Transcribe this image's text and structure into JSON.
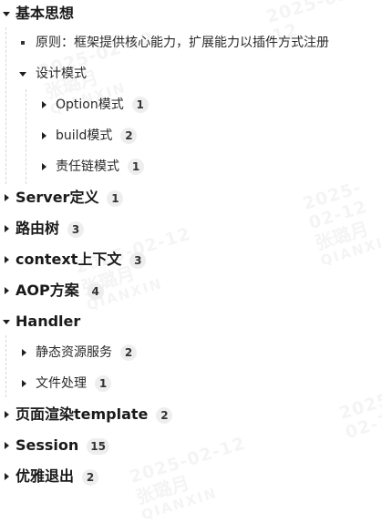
{
  "tree": {
    "nodes": [
      {
        "label": "基本思想",
        "count": null,
        "expanded": true
      },
      {
        "label": "原则：框架提供核心能力，扩展能力以插件方式注册",
        "count": null
      },
      {
        "label": "设计模式",
        "count": null,
        "expanded": true
      },
      {
        "label": "Option模式",
        "count": "1",
        "expanded": false
      },
      {
        "label": "build模式",
        "count": "2",
        "expanded": false
      },
      {
        "label": "责任链模式",
        "count": "1",
        "expanded": false
      },
      {
        "label": "Server定义",
        "count": "1",
        "expanded": false
      },
      {
        "label": "路由树",
        "count": "3",
        "expanded": false
      },
      {
        "label": "context上下文",
        "count": "3",
        "expanded": false
      },
      {
        "label": "AOP方案",
        "count": "4",
        "expanded": false
      },
      {
        "label": "Handler",
        "count": null,
        "expanded": true
      },
      {
        "label": "静态资源服务",
        "count": "2",
        "expanded": false
      },
      {
        "label": "文件处理",
        "count": "1",
        "expanded": false
      },
      {
        "label": "页面渲染template",
        "count": "2",
        "expanded": false
      },
      {
        "label": "Session",
        "count": "15",
        "expanded": false
      },
      {
        "label": "优雅退出",
        "count": "2",
        "expanded": false
      }
    ]
  },
  "watermark": {
    "date": "2025-02-12",
    "name": "张璐月",
    "company": "QIANXIN"
  },
  "colors": {
    "text": "#1f1f1f",
    "badge_bg": "#eeeeee",
    "guide_line": "#d6d6d6"
  }
}
